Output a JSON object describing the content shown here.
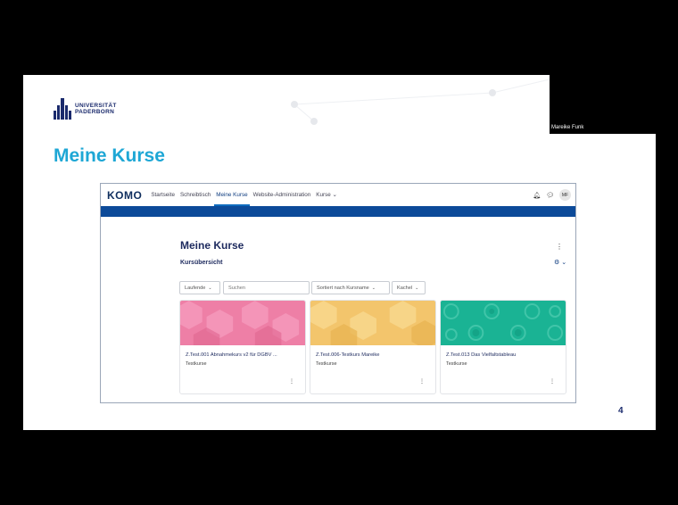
{
  "presenter": "Mareike Funk",
  "university": {
    "line1": "UNIVERSITÄT",
    "line2": "PADERBORN"
  },
  "slide_title": "Meine Kurse",
  "page_number": "4",
  "lms": {
    "brand": "KOMO",
    "nav": [
      "Startseite",
      "Schreibtisch",
      "Meine Kurse",
      "Website-Administration",
      "Kurse"
    ],
    "active_nav": "Meine Kurse",
    "kurse_dropdown_icon": "chevron-down-icon",
    "right_icons": [
      "bell-icon",
      "chat-icon"
    ],
    "avatar_initials": "MF",
    "accent": "#0c4a99"
  },
  "page": {
    "heading": "Meine Kurse",
    "section": "Kursübersicht",
    "filters": {
      "status": "Laufende",
      "search_placeholder": "Suchen",
      "sort": "Sortiert nach Kursname",
      "view": "Kachel"
    }
  },
  "courses": [
    {
      "title": "Z.Test.001 Abnahmekurs v2 für DGBV ...",
      "category": "Testkurse",
      "color": "#ee7fa6"
    },
    {
      "title": "Z.Test.006-Testkurs Mareike",
      "category": "Testkurse",
      "color": "#f3c56c"
    },
    {
      "title": "Z.Test.013 Das Vielfaltstableau",
      "category": "Testkurse",
      "color": "#1ab394"
    }
  ]
}
